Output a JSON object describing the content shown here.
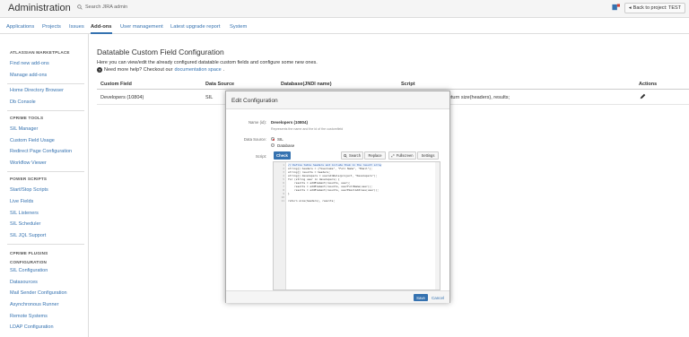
{
  "header": {
    "title": "Administration",
    "search_placeholder": "Search JIRA admin",
    "back_button": "Back to project: TEST"
  },
  "tabs": [
    {
      "label": "Applications",
      "active": false
    },
    {
      "label": "Projects",
      "active": false
    },
    {
      "label": "Issues",
      "active": false
    },
    {
      "label": "Add-ons",
      "active": true
    },
    {
      "label": "User management",
      "active": false
    },
    {
      "label": "Latest upgrade report",
      "active": false
    },
    {
      "label": "System",
      "active": false
    }
  ],
  "sidebar": {
    "sections": [
      {
        "heading": "ATLASSIAN MARKETPLACE",
        "items": [
          "Find new add-ons",
          "Manage add-ons"
        ]
      },
      {
        "heading": "",
        "items": [
          "Home Directory Browser",
          "Db Console"
        ]
      },
      {
        "heading": "CPRIME TOOLS",
        "items": [
          "SIL Manager",
          "Custom Field Usage",
          "Redirect Page Configuration",
          "Workflow Viewer"
        ]
      },
      {
        "heading": "POWER SCRIPTS",
        "items": [
          "Start/Stop Scripts",
          "Live Fields",
          "SIL Listeners",
          "SIL Scheduler",
          "SIL JQL Support"
        ]
      },
      {
        "heading": "CPRIME PLUGINS CONFIGURATION",
        "items": [
          "SIL Configuration",
          "Datasources",
          "Mail Sender Configuration",
          "Asynchronous Runner",
          "Remote Systems",
          "LDAP Configuration"
        ]
      }
    ]
  },
  "main": {
    "title": "Datatable Custom Field Configuration",
    "description": "Here you can view/edit the already configured datatable custom fields and configure some new ones.",
    "help_prefix": "Need more help? Checkout our",
    "help_link": "documentation space",
    "help_suffix": ".",
    "table": {
      "headers": [
        "Custom Field",
        "Data Source",
        "Database(JNDI name)",
        "Script",
        "Actions"
      ],
      "rows": [
        {
          "custom_field": "Developers (10804)",
          "data_source": "SIL",
          "database": "",
          "script": "return size(headers), results;"
        }
      ]
    }
  },
  "dialog": {
    "title": "Edit Configuration",
    "name_label": "Name (id):",
    "name_value": "Developers (10804)",
    "name_hint": "Represents the name and the id of the customfield",
    "data_source_label": "Data Source:",
    "data_source_options": [
      {
        "label": "SIL",
        "selected": true
      },
      {
        "label": "Database",
        "selected": false
      }
    ],
    "script_label": "Script:",
    "toolbar": {
      "check": "Check",
      "search": "Search",
      "replace": "Replace",
      "fullscreen": "Fullscreen",
      "settings": "Settings"
    },
    "code_lines": [
      "// Define table headers and include them in the result array",
      "string[] headers = {\"Username\", \"Full Name\", \"Email\"};",
      "string[] results = headers;",
      "string[] developers = usersInRole(project, \"Developers\");",
      "for (string user in developers) {",
      "    results = addElement(results, user);",
      "    results = addElement(results, userFullName(user));",
      "    results = addElement(results, userEmailAddress(user));",
      "}",
      "",
      "return size(headers), results;"
    ],
    "save_button": "Save",
    "cancel_link": "Cancel"
  },
  "colors": {
    "link": "#3572b0",
    "primary_button": "#3572b0"
  }
}
